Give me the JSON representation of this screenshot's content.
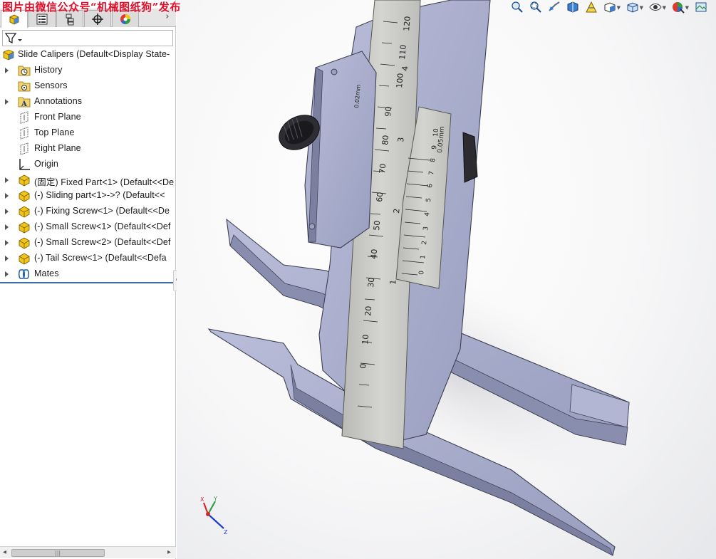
{
  "watermark": "图片由微信公众号“机械图纸狗”发布",
  "panel_tabs": [
    {
      "name": "feature-manager",
      "icon": "feature-tree-icon"
    },
    {
      "name": "property-manager",
      "icon": "property-list-icon"
    },
    {
      "name": "configuration-manager",
      "icon": "configuration-icon"
    },
    {
      "name": "dim-xpert-manager",
      "icon": "crosshair-icon"
    },
    {
      "name": "display-manager",
      "icon": "appearance-icon"
    }
  ],
  "tree": {
    "root": "Slide Calipers  (Default<Display State-",
    "items": [
      {
        "label": "History",
        "icon": "history-icon",
        "expandable": true
      },
      {
        "label": "Sensors",
        "icon": "sensor-icon",
        "expandable": false
      },
      {
        "label": "Annotations",
        "icon": "annotation-icon",
        "expandable": true
      },
      {
        "label": "Front Plane",
        "icon": "plane-icon",
        "expandable": false
      },
      {
        "label": "Top Plane",
        "icon": "plane-icon",
        "expandable": false
      },
      {
        "label": "Right Plane",
        "icon": "plane-icon",
        "expandable": false
      },
      {
        "label": "Origin",
        "icon": "origin-icon",
        "expandable": false
      },
      {
        "label": "(固定) Fixed Part<1> (Default<<De",
        "icon": "part-icon",
        "expandable": true
      },
      {
        "label": "(-) Sliding part<1>->? (Default<<",
        "icon": "part-icon",
        "expandable": true
      },
      {
        "label": "(-) Fixing Screw<1> (Default<<De",
        "icon": "part-icon",
        "expandable": true
      },
      {
        "label": "(-) Small Screw<1> (Default<<Def",
        "icon": "part-icon",
        "expandable": true
      },
      {
        "label": "(-) Small Screw<2> (Default<<Def",
        "icon": "part-icon",
        "expandable": true
      },
      {
        "label": "(-) Tail Screw<1> (Default<<Defa",
        "icon": "part-icon",
        "expandable": true
      },
      {
        "label": "Mates",
        "icon": "mates-icon",
        "expandable": true
      }
    ]
  },
  "scrollbar": {
    "grip": "|||"
  },
  "view_toolbar": [
    "zoom-to-fit-icon",
    "zoom-to-area-icon",
    "previous-view-icon",
    "section-view-icon",
    "dynamic-annotation-icon",
    "view-orientation-icon",
    "display-style-icon",
    "hide-show-icon",
    "edit-appearance-icon",
    "apply-scene-icon"
  ],
  "model": {
    "main_scale_labels": [
      "0",
      "10",
      "20",
      "30",
      "40",
      "50",
      "60",
      "70",
      "80",
      "90",
      "100",
      "110",
      "120"
    ],
    "main_scale_inner": [
      "1",
      "2",
      "3",
      "4"
    ],
    "vernier_labels": [
      "0",
      "1",
      "2",
      "3",
      "4",
      "5",
      "6",
      "7",
      "8",
      "9",
      "10"
    ],
    "vernier_precision": "0.05mm",
    "slider_mark": "0.02mm"
  },
  "triad": {
    "x": "X",
    "y": "Y",
    "z": "Z"
  },
  "colors": {
    "part": "#a3a7c7",
    "part_dark": "#6f738f",
    "scale": "#c8c9c6",
    "watermark": "#e0102a",
    "accent": "#3a6ea5"
  }
}
